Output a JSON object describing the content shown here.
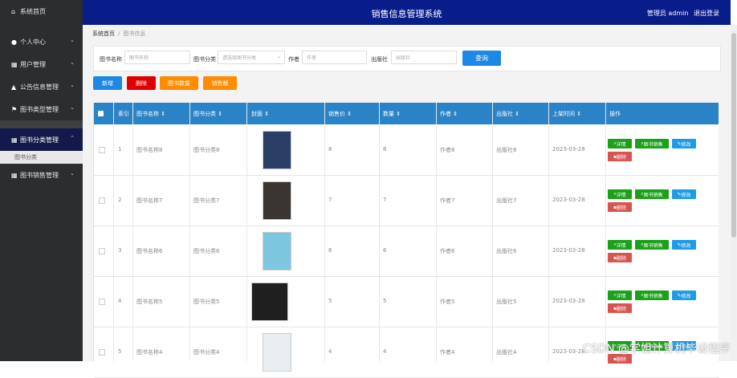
{
  "app_title": "销售信息管理系统",
  "topbar": {
    "user_text": "管理员 admin",
    "logout": "退出登录"
  },
  "sidebar": {
    "items": [
      {
        "label": "系统首页",
        "icon": "home-icon"
      },
      {
        "label": "个人中心",
        "icon": "user-icon"
      },
      {
        "label": "用户管理",
        "icon": "grid-icon"
      },
      {
        "label": "公告信息管理",
        "icon": "bank-icon"
      },
      {
        "label": "图书类型管理",
        "icon": "flag-icon"
      },
      {
        "label": "图书分类管理",
        "icon": "grid-icon"
      },
      {
        "label": "图书销售管理",
        "icon": "grid-icon"
      }
    ],
    "sub_item": "图书分类"
  },
  "breadcrumb": {
    "home": "系统首页",
    "current": "图书信息"
  },
  "search": {
    "name_label": "图书名称",
    "name_placeholder": "图书名称",
    "category_label": "图书分类",
    "category_placeholder": "请选择图书分类",
    "author_label": "作者",
    "author_placeholder": "作者",
    "publisher_label": "出版社",
    "publisher_placeholder": "出版社",
    "button": "查询"
  },
  "actions": {
    "add": "新增",
    "delete": "删除",
    "stats": "图书数量",
    "sales": "销售额"
  },
  "table": {
    "headers": [
      "索引",
      "图书名称",
      "图书分类",
      "封面",
      "销售价",
      "数量",
      "作者",
      "出版社",
      "上架时间",
      "操作"
    ],
    "rows": [
      {
        "index": "1",
        "name": "图书名称8",
        "category": "图书分类8",
        "price": "8",
        "qty": "8",
        "author": "作者8",
        "publisher": "出版社8",
        "date": "2023-03-28",
        "cover": "#2b3f66"
      },
      {
        "index": "2",
        "name": "图书名称7",
        "category": "图书分类7",
        "price": "7",
        "qty": "7",
        "author": "作者7",
        "publisher": "出版社7",
        "date": "2023-03-28",
        "cover": "#3a3530"
      },
      {
        "index": "3",
        "name": "图书名称6",
        "category": "图书分类6",
        "price": "6",
        "qty": "6",
        "author": "作者6",
        "publisher": "出版社6",
        "date": "2023-03-28",
        "cover": "#7cc6df"
      },
      {
        "index": "4",
        "name": "图书名称5",
        "category": "图书分类5",
        "price": "5",
        "qty": "5",
        "author": "作者5",
        "publisher": "出版社5",
        "date": "2023-03-28",
        "cover": "#1f1f1f"
      },
      {
        "index": "5",
        "name": "图书名称4",
        "category": "图书分类4",
        "price": "4",
        "qty": "4",
        "author": "作者4",
        "publisher": "出版社4",
        "date": "2023-03-28",
        "cover": "#e9eef3"
      }
    ],
    "ops": {
      "detail": "详情",
      "sales_detail": "图书销售",
      "edit": "修改",
      "delete": "删除"
    }
  },
  "colors": {
    "topbar": "#081c8a",
    "sidebar": "#2b2d2f",
    "thead": "#2a83c6",
    "primary": "#1e88e5",
    "green": "#1aa118",
    "red": "#d9534f",
    "orange": "#ff8c00"
  },
  "watermark": "CSDN @学姐计算机毕设程序"
}
